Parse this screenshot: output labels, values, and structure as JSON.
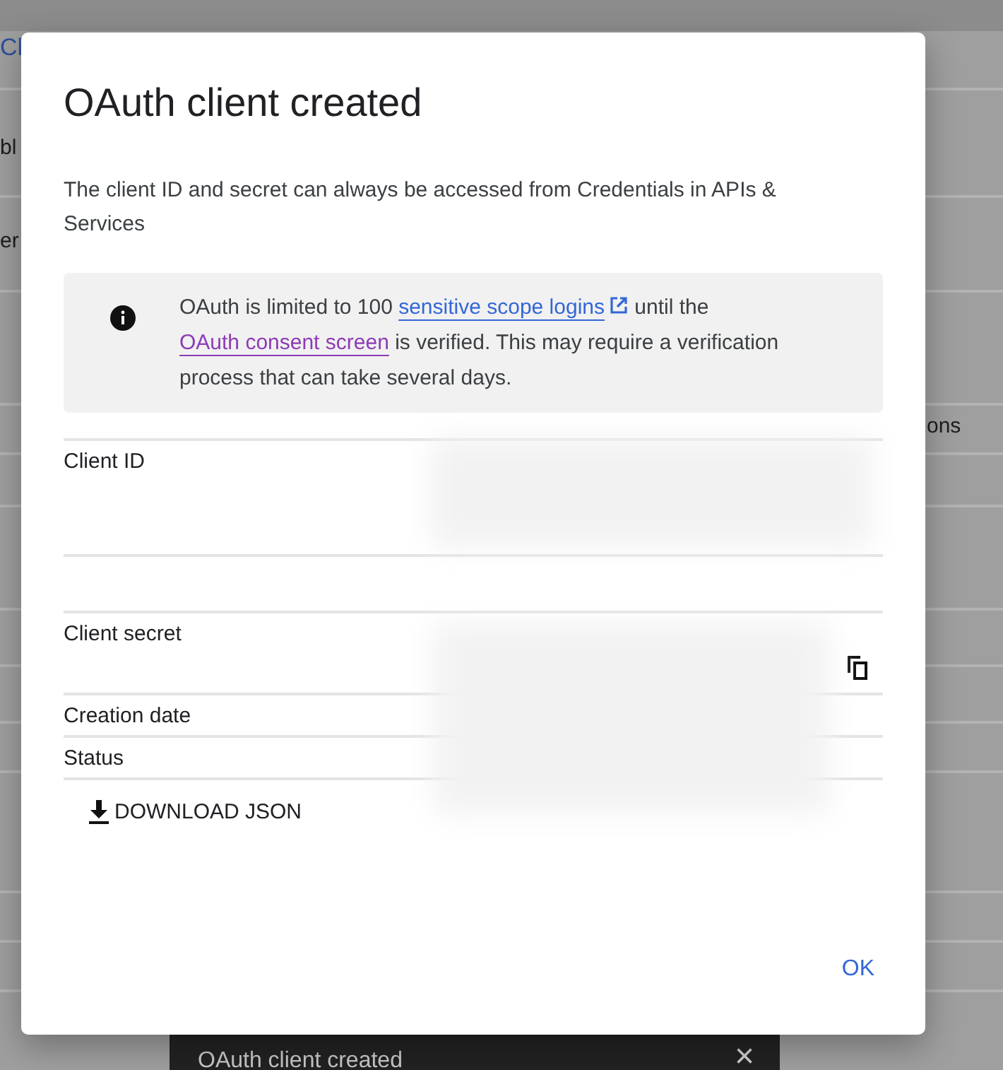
{
  "background": {
    "left_fragments": [
      {
        "text": "Cl",
        "kind": "link"
      },
      {
        "text": "bl",
        "kind": "text"
      },
      {
        "text": "er",
        "kind": "text"
      }
    ],
    "right_fragments": [
      {
        "text": "ons"
      }
    ]
  },
  "dialog": {
    "title": "OAuth client created",
    "description": "The client ID and secret can always be accessed from Credentials in APIs & Services",
    "info": [
      {
        "text": "OAuth is limited to 100 ",
        "kind": "text"
      },
      {
        "text": "sensitive scope logins",
        "kind": "link",
        "visited": false,
        "external": true
      },
      {
        "text": " until the ",
        "kind": "text"
      },
      {
        "text": "OAuth consent screen",
        "kind": "link",
        "visited": true,
        "external": false
      },
      {
        "text": " is verified. This may require a verification process that can take several days.",
        "kind": "text"
      }
    ],
    "fields": [
      {
        "label": "Client ID",
        "kind": "tall"
      },
      {
        "kind": "blank"
      },
      {
        "label": "Client secret",
        "kind": "medium",
        "copy": true
      },
      {
        "label": "Creation date",
        "kind": "short"
      },
      {
        "label": "Status",
        "kind": "short"
      }
    ],
    "download_button": "DOWNLOAD JSON",
    "ok_button": "OK"
  },
  "snackbar": {
    "message": "OAuth client created",
    "close": "×"
  }
}
